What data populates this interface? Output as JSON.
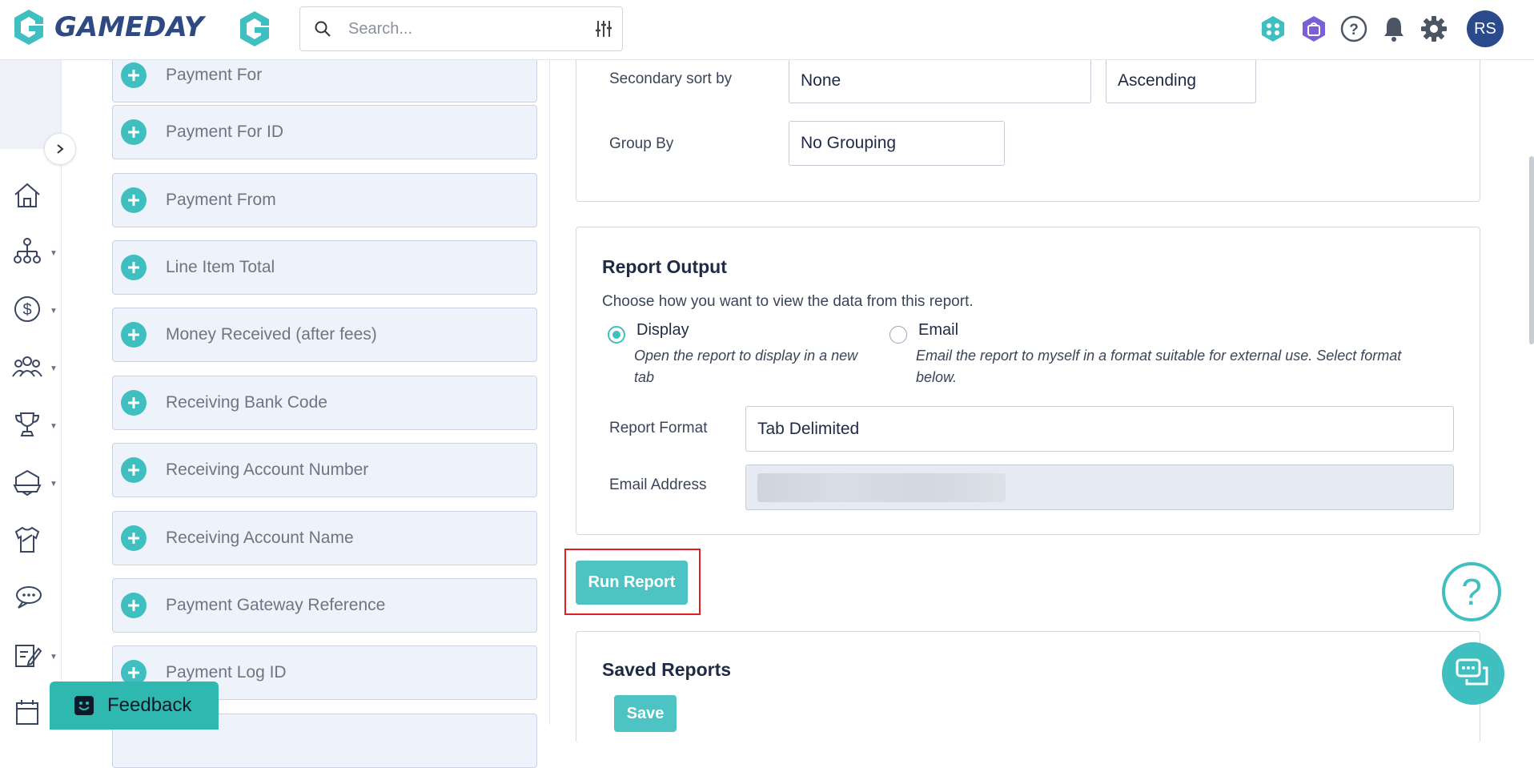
{
  "header": {
    "logo_text": "GAMEDAY",
    "search_placeholder": "Search...",
    "user_initials": "RS"
  },
  "fields": [
    {
      "label": "Payment For"
    },
    {
      "label": "Payment For ID"
    },
    {
      "label": "Payment From"
    },
    {
      "label": "Line Item Total"
    },
    {
      "label": "Money Received (after fees)"
    },
    {
      "label": "Receiving Bank Code"
    },
    {
      "label": "Receiving Account Number"
    },
    {
      "label": "Receiving Account Name"
    },
    {
      "label": "Payment Gateway Reference"
    },
    {
      "label": "Payment Log ID"
    }
  ],
  "sorting": {
    "secondary_sort_label": "Secondary sort by",
    "secondary_sort_value": "None",
    "secondary_order_value": "Ascending",
    "group_by_label": "Group By",
    "group_by_value": "No Grouping"
  },
  "report_output": {
    "title": "Report Output",
    "description": "Choose how you want to view the data from this report.",
    "display_option": {
      "title": "Display",
      "description_line1": "Open the report to display in a new",
      "description_line2": "tab",
      "selected": true
    },
    "email_option": {
      "title": "Email",
      "description_line1": "Email the report to myself in a format suitable for external use. Select format",
      "description_line2": "below.",
      "selected": false
    },
    "report_format_label": "Report Format",
    "report_format_value": "Tab Delimited",
    "email_address_label": "Email Address"
  },
  "run_report_label": "Run Report",
  "saved_reports": {
    "title": "Saved Reports",
    "save_label": "Save"
  },
  "feedback_label": "Feedback",
  "help_label": "?"
}
